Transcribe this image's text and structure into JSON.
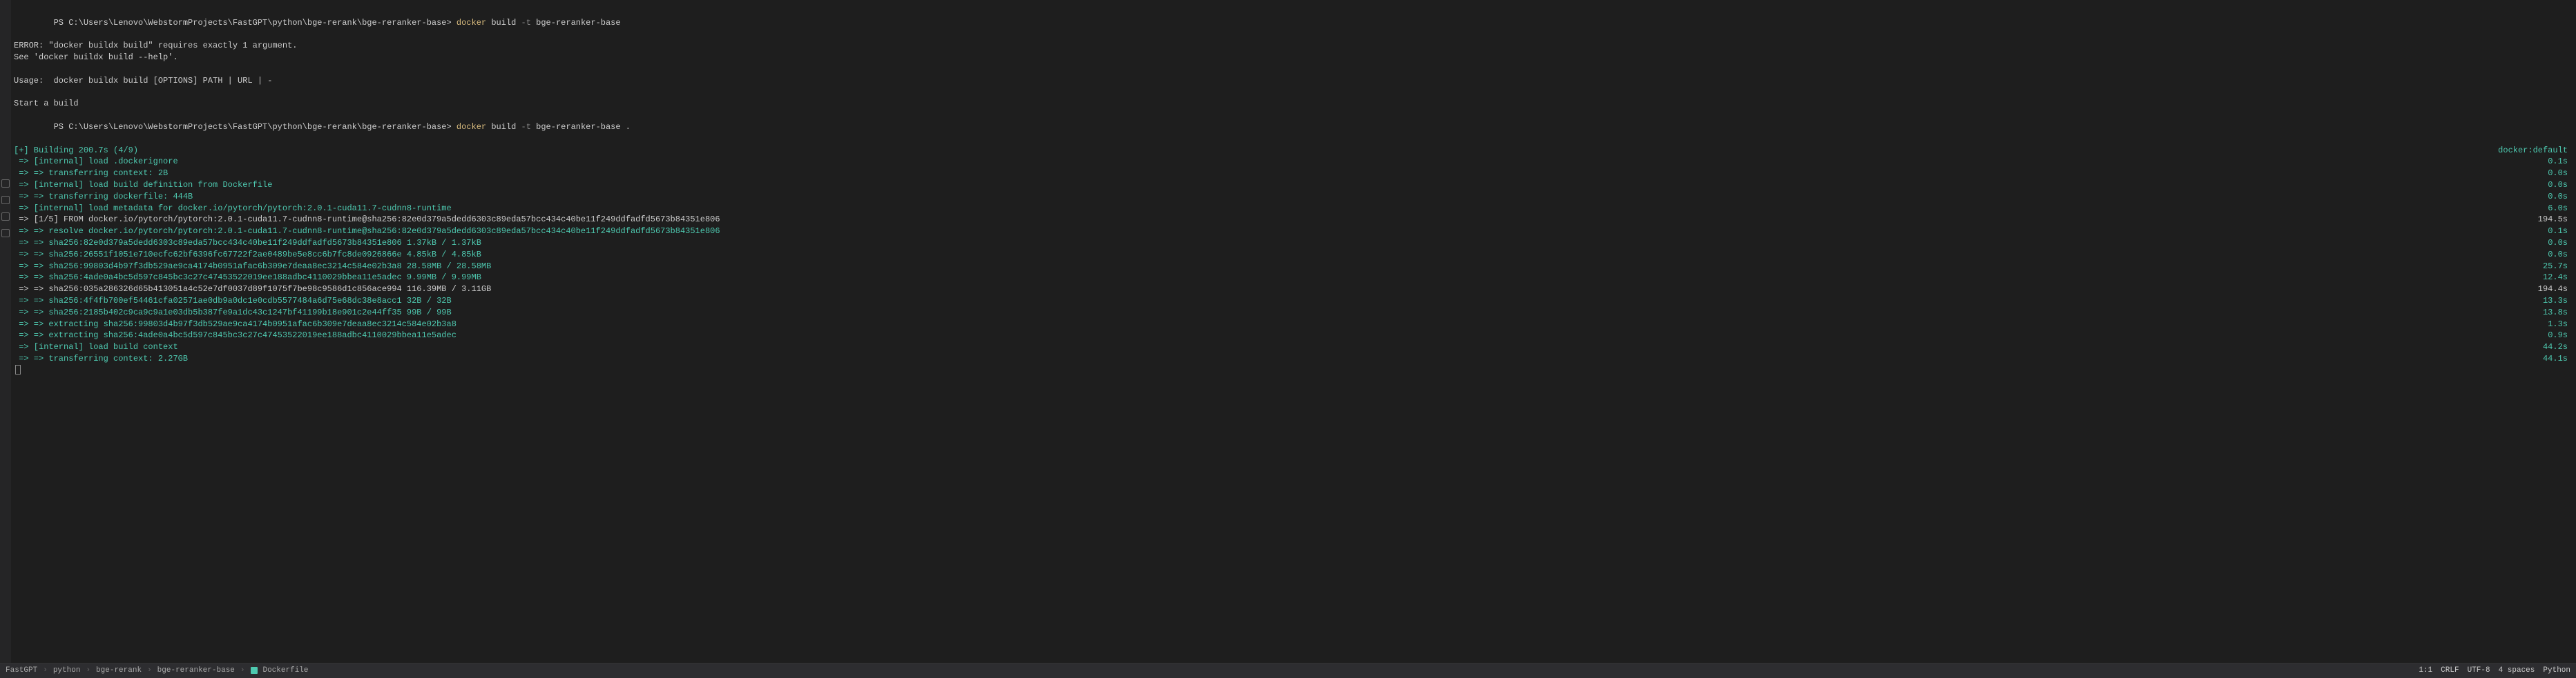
{
  "terminal": {
    "prompt1_path": "PS C:\\Users\\Lenovo\\WebstormProjects\\FastGPT\\python\\bge-rerank\\bge-reranker-base> ",
    "docker_kw": "docker",
    "build_kw": " build ",
    "flag_t": "-t",
    "img_name": " bge-reranker-base",
    "error1": "ERROR: \"docker buildx build\" requires exactly 1 argument.",
    "error2": "See 'docker buildx build --help'.",
    "usage": "Usage:  docker buildx build [OPTIONS] PATH | URL | -",
    "start": "Start a build",
    "prompt2_path": "PS C:\\Users\\Lenovo\\WebstormProjects\\FastGPT\\python\\bge-rerank\\bge-reranker-base> ",
    "img_name2": " bge-reranker-base .",
    "building": "[+] Building 200.7s (4/9)",
    "docker_default": "docker:default",
    "lines": [
      {
        "text": " => [internal] load .dockerignore",
        "time": "0.1s",
        "cls": "teal"
      },
      {
        "text": " => => transferring context: 2B",
        "time": "0.0s",
        "cls": "teal"
      },
      {
        "text": " => [internal] load build definition from Dockerfile",
        "time": "0.0s",
        "cls": "teal"
      },
      {
        "text": " => => transferring dockerfile: 444B",
        "time": "0.0s",
        "cls": "teal"
      },
      {
        "text": " => [internal] load metadata for docker.io/pytorch/pytorch:2.0.1-cuda11.7-cudnn8-runtime",
        "time": "6.0s",
        "cls": "teal"
      },
      {
        "text": " => [1/5] FROM docker.io/pytorch/pytorch:2.0.1-cuda11.7-cudnn8-runtime@sha256:82e0d379a5dedd6303c89eda57bcc434c40be11f249ddfadfd5673b84351e806",
        "time": "194.5s",
        "cls": "white"
      },
      {
        "text": " => => resolve docker.io/pytorch/pytorch:2.0.1-cuda11.7-cudnn8-runtime@sha256:82e0d379a5dedd6303c89eda57bcc434c40be11f249ddfadfd5673b84351e806",
        "time": "0.1s",
        "cls": "teal"
      },
      {
        "text": " => => sha256:82e0d379a5dedd6303c89eda57bcc434c40be11f249ddfadfd5673b84351e806 1.37kB / 1.37kB",
        "time": "0.0s",
        "cls": "teal"
      },
      {
        "text": " => => sha256:26551f1051e710ecfc62bf6396fc67722f2ae0489be5e8cc6b7fc8de0926866e 4.85kB / 4.85kB",
        "time": "0.0s",
        "cls": "teal"
      },
      {
        "text": " => => sha256:99803d4b97f3db529ae9ca4174b0951afac6b309e7deaa8ec3214c584e02b3a8 28.58MB / 28.58MB",
        "time": "25.7s",
        "cls": "teal"
      },
      {
        "text": " => => sha256:4ade0a4bc5d597c845bc3c27c47453522019ee188adbc4110029bbea11e5adec 9.99MB / 9.99MB",
        "time": "12.4s",
        "cls": "teal"
      },
      {
        "text": " => => sha256:035a286326d65b413051a4c52e7df0037d89f1075f7be98c9586d1c856ace994 116.39MB / 3.11GB",
        "time": "194.4s",
        "cls": "white"
      },
      {
        "text": " => => sha256:4f4fb700ef54461cfa02571ae0db9a0dc1e0cdb5577484a6d75e68dc38e8acc1 32B / 32B",
        "time": "13.3s",
        "cls": "teal"
      },
      {
        "text": " => => sha256:2185b402c9ca9c9a1e03db5b387fe9a1dc43c1247bf41199b18e901c2e44ff35 99B / 99B",
        "time": "13.8s",
        "cls": "teal"
      },
      {
        "text": " => => extracting sha256:99803d4b97f3db529ae9ca4174b0951afac6b309e7deaa8ec3214c584e02b3a8",
        "time": "1.3s",
        "cls": "teal"
      },
      {
        "text": " => => extracting sha256:4ade0a4bc5d597c845bc3c27c47453522019ee188adbc4110029bbea11e5adec",
        "time": "0.9s",
        "cls": "teal"
      },
      {
        "text": " => [internal] load build context",
        "time": "44.2s",
        "cls": "teal"
      },
      {
        "text": " => => transferring context: 2.27GB",
        "time": "44.1s",
        "cls": "teal"
      }
    ]
  },
  "breadcrumb": {
    "items": [
      "FastGPT",
      "python",
      "bge-rerank",
      "bge-reranker-base",
      "Dockerfile"
    ]
  },
  "status": {
    "pos": "1:1",
    "eol": "CRLF",
    "enc": "UTF-8",
    "indent": "4 spaces",
    "lang": "Python"
  }
}
